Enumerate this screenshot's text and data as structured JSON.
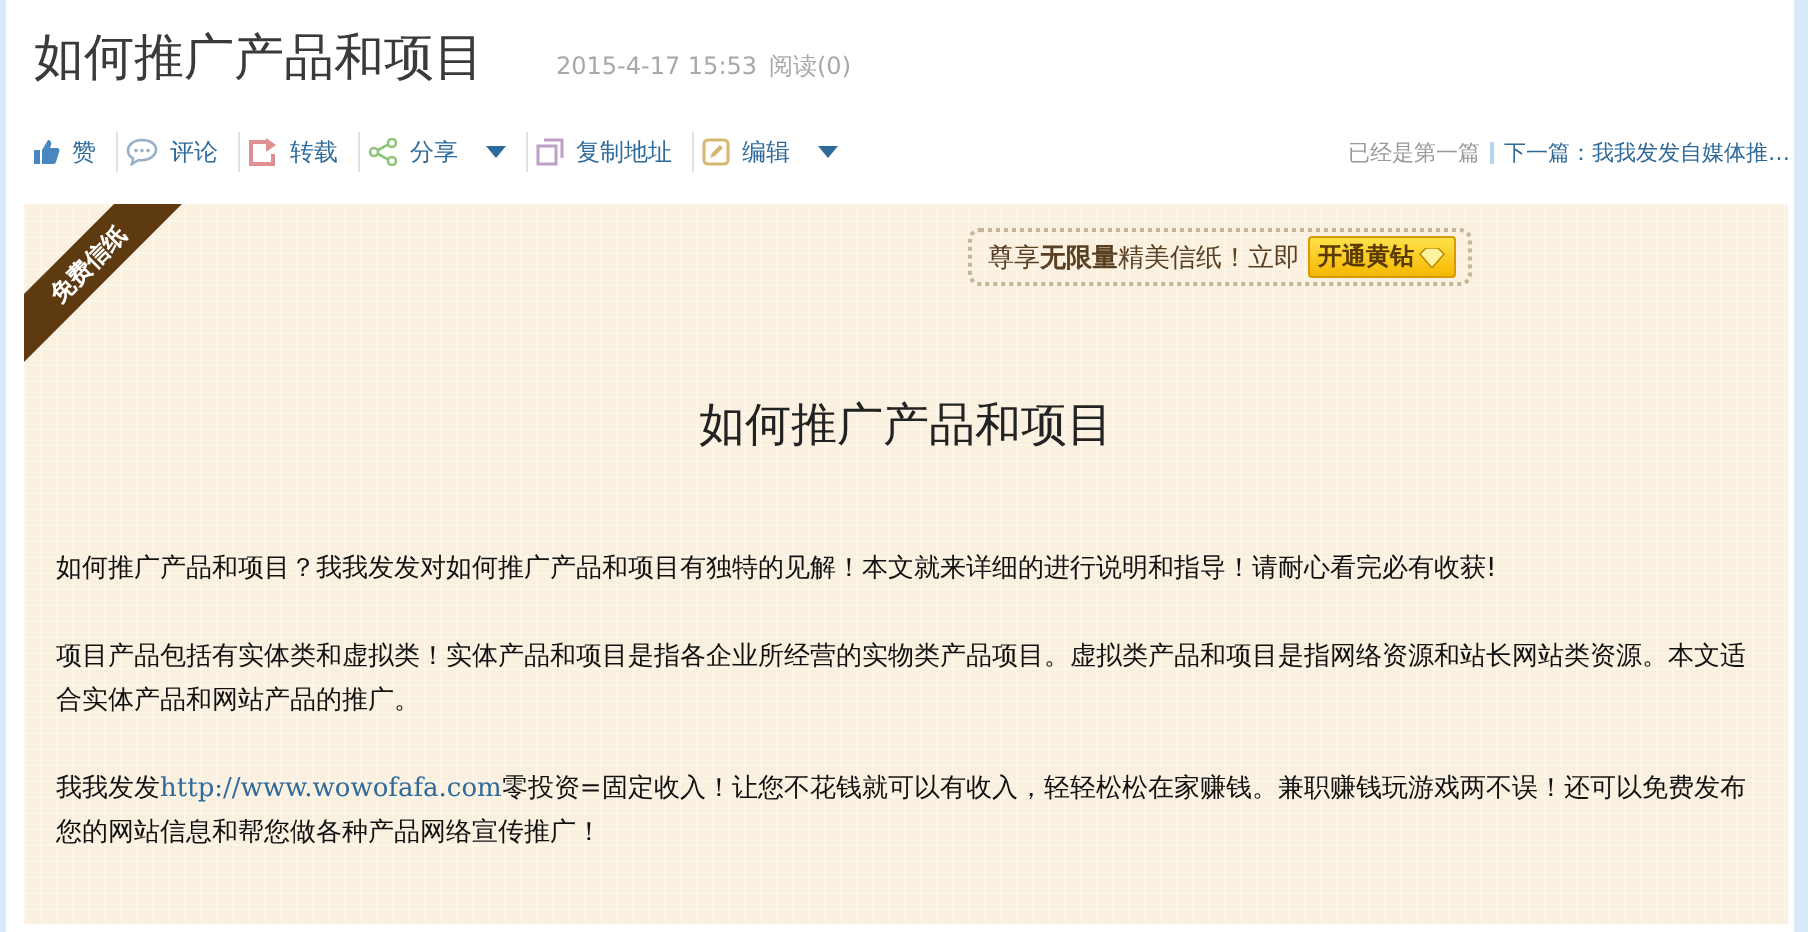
{
  "article": {
    "title": "如何推广产品和项目",
    "date": "2015-4-17 15:53",
    "reads": "阅读(0)"
  },
  "toolbar": [
    {
      "label": "赞",
      "dropdown": false
    },
    {
      "label": "评论",
      "dropdown": false
    },
    {
      "label": "转载",
      "dropdown": false
    },
    {
      "label": "分享",
      "dropdown": true
    },
    {
      "label": "复制地址",
      "dropdown": false
    },
    {
      "label": "编辑",
      "dropdown": true
    }
  ],
  "navigation": {
    "previous": "已经是第一篇",
    "next": "下一篇：我我发发自媒体推…"
  },
  "letter": {
    "ribbon": "免费信纸",
    "promo": "尊享**无限量**精美信纸！立即",
    "promo_button": "开通黄钻",
    "title": "如何推广产品和项目",
    "paragraphs": [
      [
        {
          "text": "如何推广产品和项目？我我发发对如何推广产品和项目有独特的见解！本文就来详细的进行说明和指导！请耐心看完必有收获!"
        }
      ],
      [
        {
          "text": "项目产品包括有实体类和虚拟类！实体产品和项目是指各企业所经营的实物类产品项目。虚拟类产品和项目是指网络资源和站长网站类资源。本文适合实体产品和网站产品的推广。"
        }
      ],
      [
        {
          "text": "我我发发"
        },
        {
          "text": "http://www.wowofafa.com",
          "link": true
        },
        {
          "text": "零投资=固定收入！让您不花钱就可以有收入，轻轻松松在家赚钱。兼职赚钱玩游戏两不误！还可以免费发布您的网站信息和帮您做各种产品网络宣传推广！"
        }
      ]
    ]
  }
}
